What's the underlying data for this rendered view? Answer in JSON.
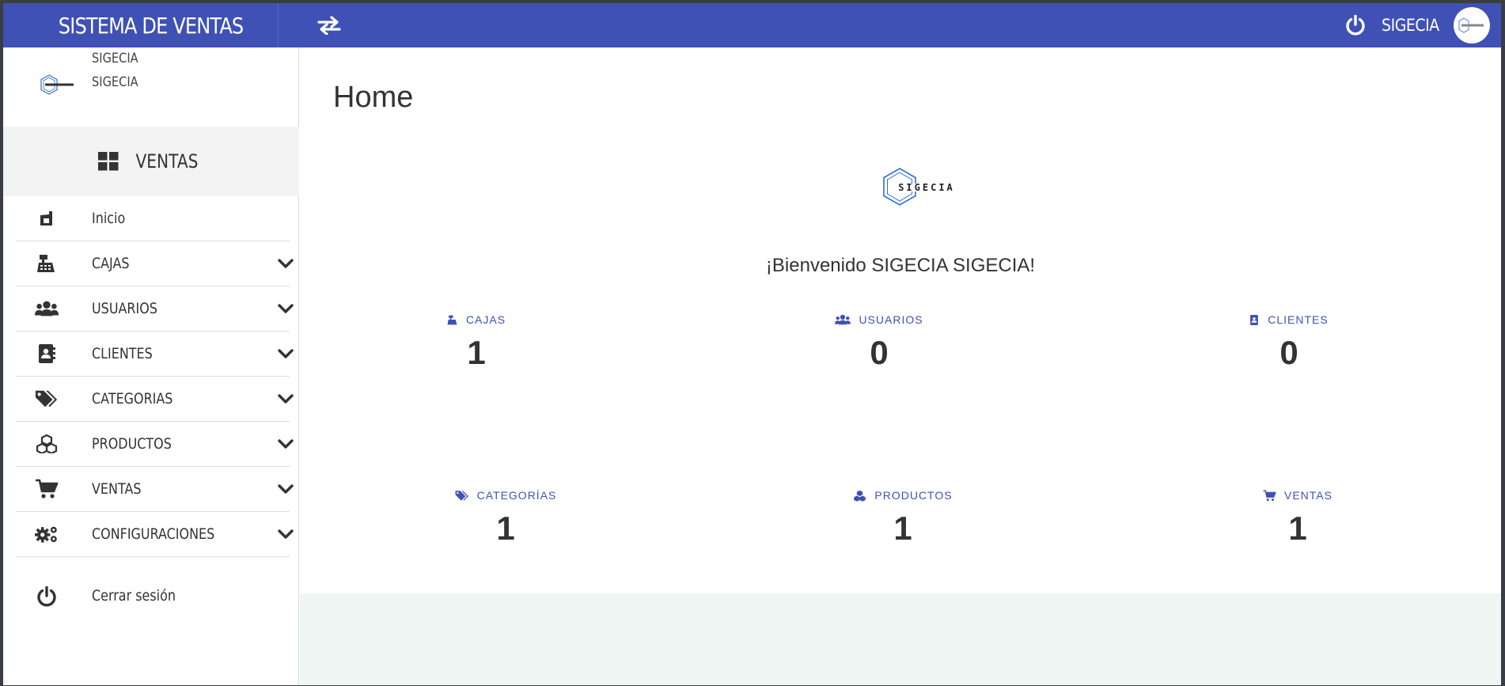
{
  "header": {
    "brand": "SISTEMA DE VENTAS",
    "user_name": "SIGECIA",
    "color": "#3f51b5"
  },
  "sidebar": {
    "user": {
      "name": "SIGECIA",
      "role": "SIGECIA"
    },
    "section_title": "VENTAS",
    "items": [
      {
        "label": "Inicio",
        "icon": "home-icon",
        "expandable": false
      },
      {
        "label": "CAJAS",
        "icon": "cash-register-icon",
        "expandable": true
      },
      {
        "label": "USUARIOS",
        "icon": "users-icon",
        "expandable": true
      },
      {
        "label": "CLIENTES",
        "icon": "address-book-icon",
        "expandable": true
      },
      {
        "label": "CATEGORIAS",
        "icon": "tags-icon",
        "expandable": true
      },
      {
        "label": "PRODUCTOS",
        "icon": "cubes-icon",
        "expandable": true
      },
      {
        "label": "VENTAS",
        "icon": "cart-icon",
        "expandable": true
      },
      {
        "label": "CONFIGURACIONES",
        "icon": "cogs-icon",
        "expandable": true
      }
    ],
    "logout": "Cerrar sesión"
  },
  "main": {
    "title": "Home",
    "logo_text": "SIGECIA",
    "welcome": "¡Bienvenido SIGECIA SIGECIA!",
    "stats": [
      {
        "label": "CAJAS",
        "value": "1",
        "icon": "cash-register-icon"
      },
      {
        "label": "USUARIOS",
        "value": "0",
        "icon": "users-icon"
      },
      {
        "label": "CLIENTES",
        "value": "0",
        "icon": "address-book-icon"
      },
      {
        "label": "CATEGORÍAS",
        "value": "1",
        "icon": "tags-icon"
      },
      {
        "label": "PRODUCTOS",
        "value": "1",
        "icon": "cubes-icon"
      },
      {
        "label": "VENTAS",
        "value": "1",
        "icon": "cart-icon"
      }
    ]
  }
}
